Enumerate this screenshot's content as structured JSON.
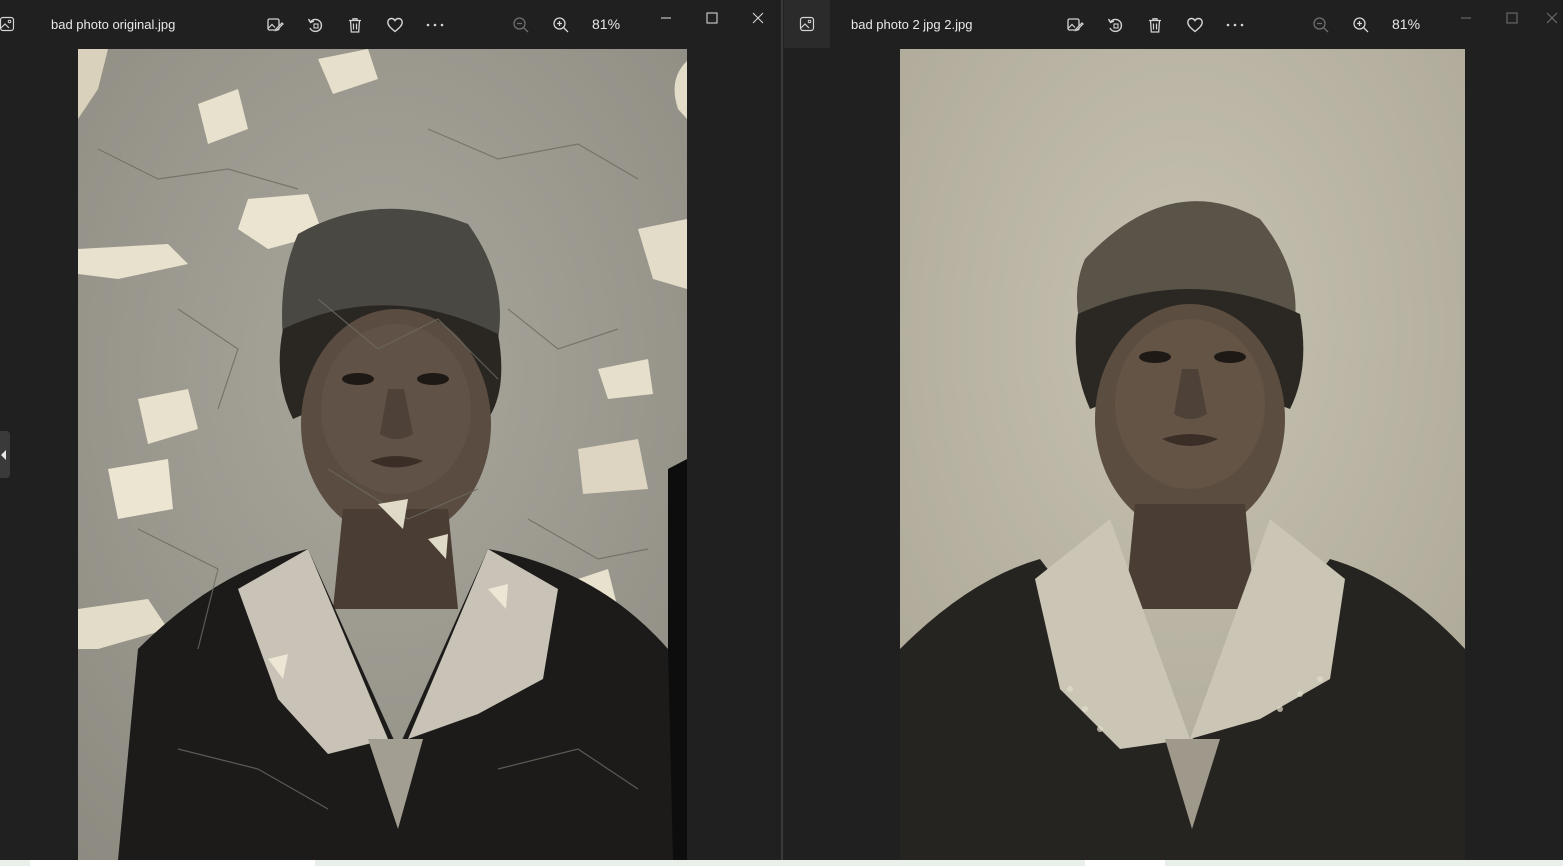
{
  "left_window": {
    "title": "bad photo original.jpg",
    "zoom": "81%",
    "photo_alt": "Damaged vintage portrait photograph with peeling emulsion",
    "toolbar": [
      "edit-image-icon",
      "rotate-icon",
      "delete-icon",
      "favorite-icon",
      "more-icon",
      "zoom-out-icon",
      "zoom-in-icon"
    ],
    "window_controls": [
      "minimize-icon",
      "maximize-icon",
      "close-icon"
    ]
  },
  "right_window": {
    "title": "bad photo 2 jpg 2.jpg",
    "zoom": "81%",
    "photo_alt": "Restored vintage portrait photograph",
    "toolbar": [
      "edit-image-icon",
      "rotate-icon",
      "delete-icon",
      "favorite-icon",
      "more-icon",
      "zoom-out-icon",
      "zoom-in-icon"
    ],
    "window_controls": [
      "minimize-icon",
      "maximize-icon",
      "close-icon"
    ]
  },
  "colors": {
    "background": "#1f1f1f",
    "titlebar": "#202020",
    "text": "#e8e8e8",
    "icon": "#d4d4d4",
    "icon_dim": "#6e6e6e"
  }
}
